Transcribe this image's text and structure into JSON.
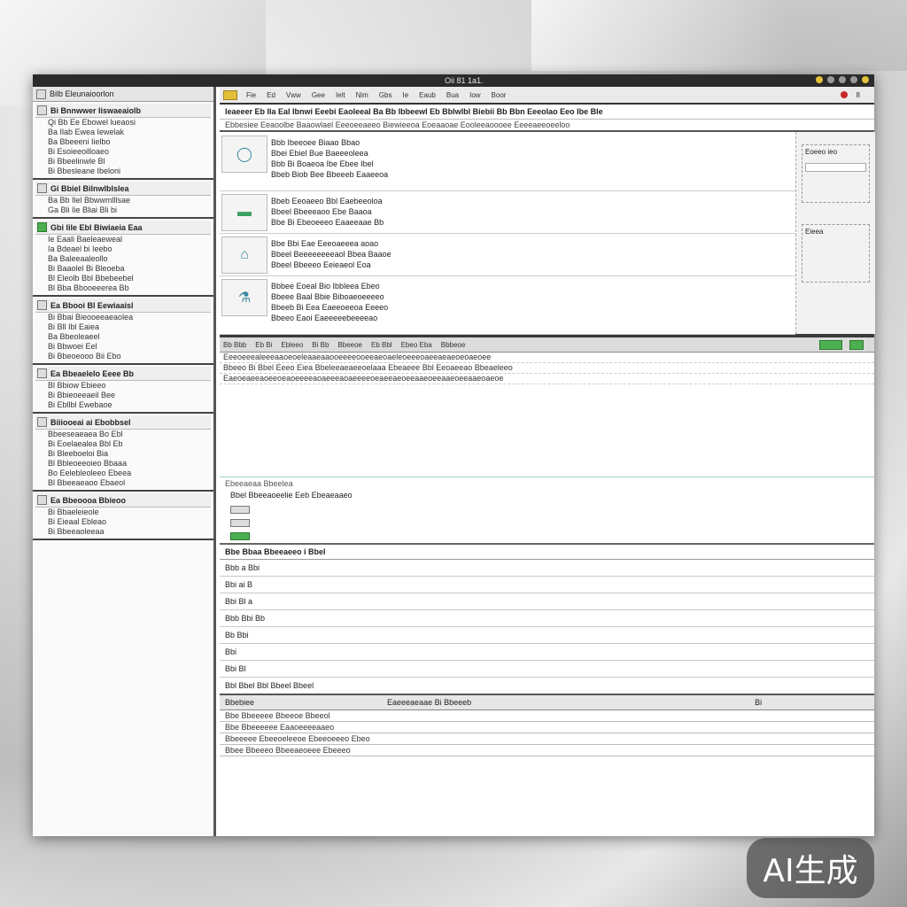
{
  "window": {
    "title": "Oii 81 1a1."
  },
  "sidebar": {
    "header": "Bilb Eleunaioorlon",
    "groups": [
      {
        "title": "Bi Bnnwwer Iiswaeaiolb",
        "rows": [
          "Qi Bb Ee Ebowel lueaosi",
          "Ba Ilab Ewea Iewelak",
          "Ba Bbeeeni Iielbo",
          "Bi Esoieeoilloaeo",
          "Bi Bbeelinwle Bl",
          "Bi Bbesleane Ibeloni"
        ]
      },
      {
        "title": "Gi Bbiel Bilnwlblslea",
        "rows": [
          "Ba Bb Ilel Bbwwmlllsae",
          "Ga Bli Iie Bliai Bli bi"
        ]
      },
      {
        "title": "Gbi lile Ebl Biwiaeia Eaa",
        "rows": [
          "Ie Eaali Baeleaeweal",
          "Ia Bdeael bi Ieebo",
          "Ba Baleeaaleollo",
          "Bi Baaolel Bi Bleoeba",
          "Bl Eleolb Bbl Bbebeebel",
          "Bl Bba Bbooeeerea Bb"
        ]
      },
      {
        "title": "Ea Bbooi Bl Eewiaaisl",
        "rows": [
          "Bi Bbai Bieooeeaeaolea",
          "Bi Bll Ibl Eaiea",
          "Ba Bbeoleaeel",
          "Bi Bbwoei Eel",
          "Bi Bbeoeooo Bii Ebo"
        ]
      },
      {
        "title": "Ea Bbeaelelo Eeee Bb",
        "rows": [
          "Bl Bbiow Ebieeo",
          "Bi Bbieoeeaeil Bee",
          "Bi Ebllbl Ewebaoe"
        ]
      },
      {
        "title": "Biiiooeai ai Ebobbsel",
        "rows": [
          "Bbeeseaeaea Bo Ebl",
          "Bi Eoelaealea Bbl Eb",
          "Bi Bleeboeloi Bia",
          "Bl Bbleoeeoieo Bbaaa",
          "Bo Eelebleoleeo Ebeea",
          "Bl Bbeeaeaoo Ebaeol"
        ]
      },
      {
        "title": "Ea Bbeoooa Bbieoo",
        "rows": [
          "Bi Bbaeleieole",
          "Bi Eieaal Ebleao",
          "Bi Bbeeaoleeaa"
        ]
      }
    ]
  },
  "toolbar": {
    "items": [
      "Fie",
      "Ed",
      "Vww",
      "Gee",
      "Ielt",
      "Nim",
      "Gbs",
      "Ie",
      "Eaub",
      "Bua",
      "Iow",
      "Boor"
    ],
    "counter": "8"
  },
  "main": {
    "header": "Ieaeeer Eb Ila Eal Ibnwi Eeebi Eaoleeal Ba Bb Ibbeewl Eb Bblwlbl Biebii Bb Bbn Eeeolao Eeo Ibe Ble",
    "subheader": "Ebbesiee Eeaoolbe Baaowlael Eeeoeeaeeo Biewieeoa Eoeaaoae Eooleeaoooee Eeeeaeeoeeloo",
    "cards": [
      {
        "lines": [
          "Bbb Ibeeoee Biaao Bbao",
          "Bbei Ebiel Bue Baeeeoleea",
          "Bbb Bi Boaeoa Ibe Ebee Ibel",
          "Bbeb Biob Bee Bbeeeb Eaaeeoa"
        ]
      },
      {
        "lines": [
          "Bbeb Eeoaeeo Bbl Eaebeeoloa",
          "Bbeel Bbeeeaoo Ebe Baaoa",
          "Bbe Bi Ebeoeeeo Eaaeeaae Bb"
        ]
      },
      {
        "lines": [
          "Bbe Bbi Eae Eeeoaeeea aoao",
          "Bbeel Beeeeeeeeaol Bbea Baaoe",
          "Bbeel Bbeeeo Eeieaeol Eoa"
        ]
      },
      {
        "lines": [
          "Bbbee Eoeal Bio Ibbleea Ebeo",
          "Bbeee Baal Bbie Biboaeoeeeeo",
          "Bbeeb Bi Eea Eaeeoeeoa Eeeeo",
          "Bbeeo Eaoi Eaeeeeebeeeeao"
        ]
      }
    ],
    "right_panel": {
      "label1": "Eoeeo ieo",
      "label2": "Eieea"
    },
    "editor": {
      "bar_items": [
        "Bb Bbb",
        "Eb Bi",
        "Ebleeo",
        "Bi Bb",
        "Bbeeoe",
        "Eb Bbl",
        "Ebeo Eba",
        "Bbbeoe"
      ],
      "lines": [
        "Eeeoeeealeeeaaoeoeleaaeaaooeeeeooeeaeoaeleoeeeoaeeaeaeoeoaeoee",
        "Bbeeo Bi Bbel Eeeo Eiea Bbeleeaeaeeoelaaa Ebeaeee Bbl Eeoaeeao Bbeaeleeo",
        "Eaeoeaeeaoeeoeaoeeeeaoaeeeaoaeeeeoeaeeaeoeeaaeoeeaaeoeeaaeoaeoe"
      ]
    },
    "preview": {
      "title": "Ebeeaeaa Bbeelea",
      "line": "Bbel Bbeeaoeelie Eeb Ebeaeaaeo"
    },
    "grid": {
      "header": "Bbe Bbaa Bbeeaeeo i Bbel",
      "rows": [
        "Bbb a Bbi",
        "Bbi ai B",
        "Bbi Bl a",
        "Bbb Bbi Bb",
        "Bb Bbi",
        "Bbi",
        "Bbi Bl"
      ],
      "footer": "Bbl Bbel Bbl Bbeel Bbeel"
    },
    "status": {
      "left": "Bbebiee",
      "mid": "Eaeeeaeaae Bi Bbeeeb",
      "right": "Bi"
    },
    "output": [
      "Bbe Bbeeeee Bbeeoe Bbeeol",
      "Bbe Bbeeeeee Eaaoeeeeaaeo",
      "Bbeeeee Ebeeoeleeoe Ebeeoeeeo Ebeo",
      "Bbee Bbeeeo Bbeeaeoeee Ebeeeo"
    ]
  },
  "watermark": "AI生成"
}
